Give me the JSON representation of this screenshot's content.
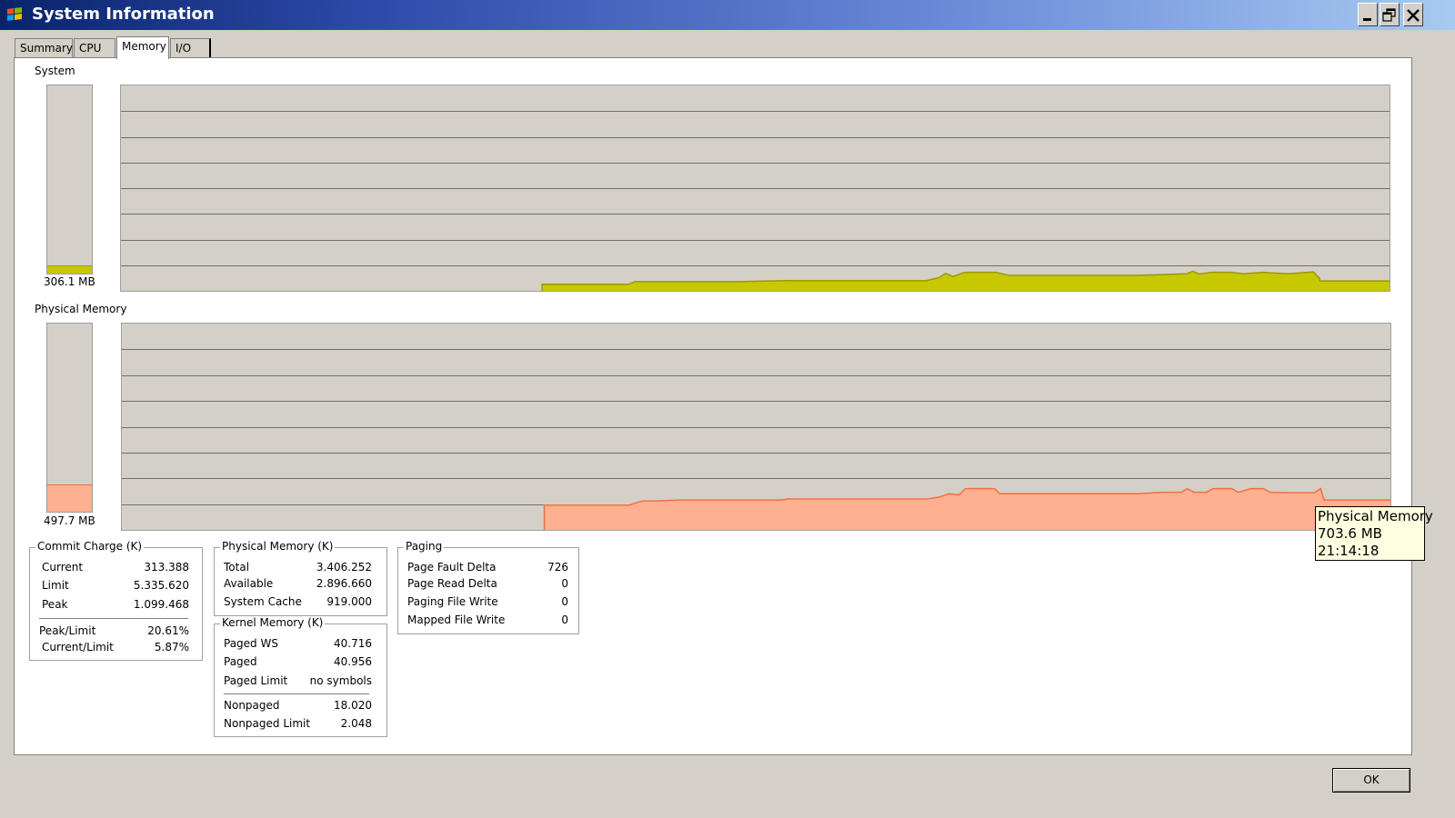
{
  "window": {
    "title": "System Information"
  },
  "tabs": [
    {
      "label": "Summary"
    },
    {
      "label": "CPU"
    },
    {
      "label": "Memory",
      "active": true
    },
    {
      "label": "I/O"
    }
  ],
  "system": {
    "label": "System",
    "value": "306.1 MB",
    "gauge_fraction": 0.04,
    "color": "#c8c800",
    "line_color": "#999900"
  },
  "physical": {
    "label": "Physical Memory",
    "value": "497.7 MB",
    "gauge_fraction": 0.14,
    "color": "#ffb090",
    "line_color": "#f07040"
  },
  "commit": {
    "title": "Commit Charge (K)",
    "rows": [
      {
        "k": "Current",
        "v": "313.388"
      },
      {
        "k": "Limit",
        "v": "5.335.620"
      },
      {
        "k": "Peak",
        "v": "1.099.468"
      },
      {
        "k": "Peak/Limit",
        "v": "20.61%"
      },
      {
        "k": "Current/Limit",
        "v": "5.87%"
      }
    ]
  },
  "physmem": {
    "title": "Physical Memory (K)",
    "rows": [
      {
        "k": "Total",
        "v": "3.406.252"
      },
      {
        "k": "Available",
        "v": "2.896.660"
      },
      {
        "k": "System Cache",
        "v": "919.000"
      }
    ]
  },
  "kernel": {
    "title": "Kernel Memory (K)",
    "rows": [
      {
        "k": "Paged WS",
        "v": "40.716"
      },
      {
        "k": "Paged",
        "v": "40.956"
      },
      {
        "k": "Paged Limit",
        "v": "no symbols"
      },
      {
        "k": "Nonpaged",
        "v": "18.020"
      },
      {
        "k": "Nonpaged Limit",
        "v": "2.048"
      }
    ]
  },
  "paging": {
    "title": "Paging",
    "rows": [
      {
        "k": "Page Fault Delta",
        "v": "726"
      },
      {
        "k": "Page Read Delta",
        "v": "0"
      },
      {
        "k": "Paging File Write",
        "v": "0"
      },
      {
        "k": "Mapped File Write",
        "v": "0"
      }
    ]
  },
  "tooltip": {
    "title": "Physical Memory",
    "value": "703.6 MB",
    "time": "21:14:18"
  },
  "buttons": {
    "ok": "OK"
  },
  "icons": {
    "app": "windows-flag-icon",
    "minimize": "minimize-icon",
    "maximize": "restore-icon",
    "close": "close-icon"
  }
}
